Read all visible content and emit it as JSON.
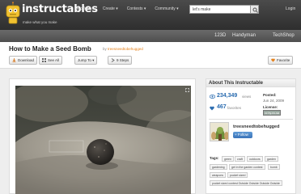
{
  "site": {
    "logo": "instructables",
    "tagline": "make what you make"
  },
  "nav": [
    "Explore ▾",
    "Create ▾",
    "Contests ▾",
    "Community ▾"
  ],
  "search": {
    "value": "let's make"
  },
  "login": "Login",
  "promos": [
    "123D",
    "Handyman",
    "TechShop"
  ],
  "instructable": {
    "title": "How to Make a Seed Bomb",
    "by_prefix": "by",
    "author": "treesneedtobehugged"
  },
  "toolbar": {
    "download": "Download",
    "see_all": "See All",
    "jump_to": "Jump To ▾",
    "steps": "9 Steps",
    "favorite": "Favorite"
  },
  "sidebar": {
    "heading": "About This Instructable",
    "views": "234,349",
    "views_label": "views",
    "favorites": "467",
    "favorites_label": "favorites",
    "posted_label": "Posted:",
    "posted_date": "Jun 24, 2009",
    "license_label": "License:",
    "license_badge": "cc by-nc-sa",
    "username": "treesneedtobehugged",
    "follow": "+ Follow",
    "tags_label": "Tags:",
    "tags": [
      "green",
      "craft",
      "outdoors",
      "garden",
      "gardening",
      "get in the garden contest",
      "bomb",
      "weapons",
      "pocket sized",
      "pocket sized contest Outside Outside Outside Outside"
    ]
  },
  "colors": {
    "accent": "#e4811c",
    "link_blue": "#2b6cb0",
    "follow_blue": "#3b74b8"
  }
}
